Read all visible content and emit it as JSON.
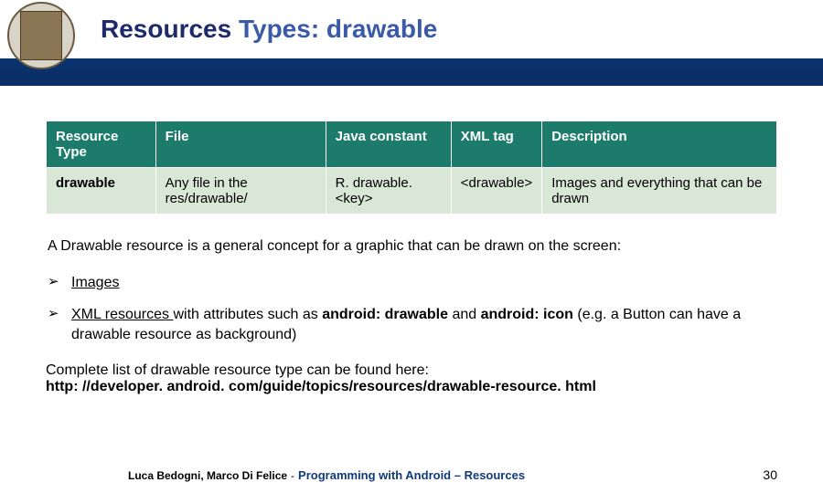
{
  "title": {
    "part1": "Resources ",
    "part2": "Types: drawable"
  },
  "table": {
    "headers": [
      "Resource Type",
      "File",
      "Java constant",
      "XML tag",
      "Description"
    ],
    "row": {
      "type": "drawable",
      "file": "Any file in the res/drawable/",
      "constant": "R. drawable. <key>",
      "xml": "<drawable>",
      "desc": "Images and everything that can be drawn"
    }
  },
  "intro": "A Drawable resource is a general concept for a graphic that can be drawn on the screen:",
  "bullets": [
    {
      "lead": "Images",
      "rest": ""
    },
    {
      "lead": "XML resources ",
      "rest_pre": "with attributes such as ",
      "b1": "android: drawable",
      "mid": " and ",
      "b2": "android: icon",
      "rest_post": " (e.g. a Button can have a drawable resource as background)"
    }
  ],
  "link": {
    "pre": "Complete list of drawable resource type can be found here:",
    "url": "http: //developer. android. com/guide/topics/resources/drawable-resource. html"
  },
  "footer": {
    "authors": "Luca Bedogni, Marco Di Felice",
    "sep": "-",
    "prog": "Programming with Android – Resources",
    "page": "30"
  }
}
